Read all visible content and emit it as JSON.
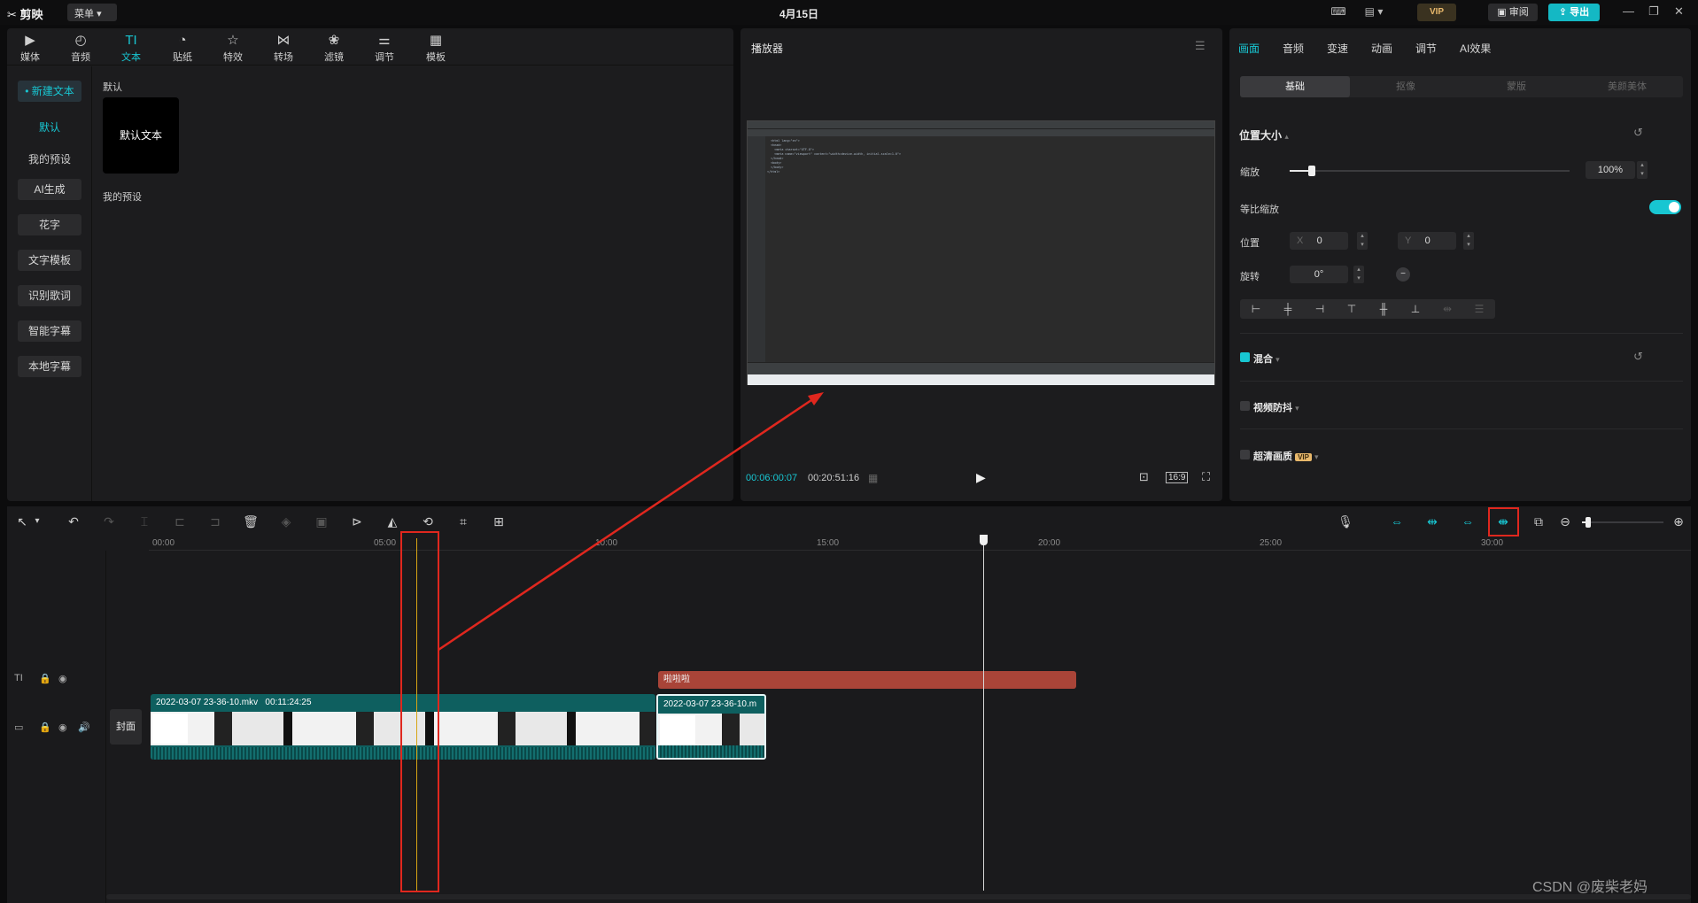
{
  "titlebar": {
    "app_name": "剪映",
    "menu_label": "菜单",
    "date": "4月15日",
    "vip_label": "VIP",
    "review_label": "审阅",
    "export_label": "导出"
  },
  "library": {
    "tabs": [
      {
        "label": "媒体",
        "icon": "media-icon"
      },
      {
        "label": "音频",
        "icon": "audio-icon"
      },
      {
        "label": "文本",
        "icon": "text-icon"
      },
      {
        "label": "贴纸",
        "icon": "sticker-icon"
      },
      {
        "label": "特效",
        "icon": "effects-icon"
      },
      {
        "label": "转场",
        "icon": "transition-icon"
      },
      {
        "label": "滤镜",
        "icon": "filter-icon"
      },
      {
        "label": "调节",
        "icon": "adjust-icon"
      },
      {
        "label": "模板",
        "icon": "template-icon"
      }
    ],
    "active_tab": "文本",
    "sidebar": {
      "new_text": "• 新建文本",
      "default": "默认",
      "my_presets": "我的预设",
      "ai": "AI生成",
      "fancy": "花字",
      "template": "文字模板",
      "lyrics": "识别歌词",
      "smart_subs": "智能字幕",
      "local_subs": "本地字幕"
    },
    "section_default": "默认",
    "card_label": "默认文本",
    "section_presets": "我的预设"
  },
  "player": {
    "title": "播放器",
    "current_time": "00:06:00:07",
    "total_time": "00:20:51:16",
    "ratio": "16:9"
  },
  "props": {
    "tabs": [
      "画面",
      "音频",
      "变速",
      "动画",
      "调节",
      "AI效果"
    ],
    "active_tab": "画面",
    "segments": [
      "基础",
      "抠像",
      "蒙版",
      "美颜美体"
    ],
    "active_segment": "基础",
    "pos_size": "位置大小",
    "scale_label": "缩放",
    "scale_value": "100%",
    "scale_fraction": 0.08,
    "uniform_label": "等比缩放",
    "uniform_on": true,
    "position_label": "位置",
    "x_label": "X",
    "x_value": "0",
    "y_label": "Y",
    "y_value": "0",
    "rotate_label": "旋转",
    "rotate_value": "0°",
    "blend_label": "混合",
    "stabilize_label": "视频防抖",
    "hd_label": "超清画质",
    "hd_badge": "VIP"
  },
  "timeline": {
    "ticks": [
      "00:00",
      "05:00",
      "10:00",
      "15:00",
      "20:00",
      "25:00",
      "30:00"
    ],
    "cover_label": "封面",
    "text_clip_label": "啦啦啦",
    "clip1_name": "2022-03-07 23-36-10.mkv",
    "clip1_duration": "00:11:24:25",
    "clip2_name": "2022-03-07 23-36-10.m"
  },
  "watermark": "CSDN @废柴老妈",
  "colors": {
    "accent": "#18c6d2",
    "annotation": "#e0271e",
    "text_clip": "#a94438",
    "video_clip": "#0e5f5f"
  }
}
